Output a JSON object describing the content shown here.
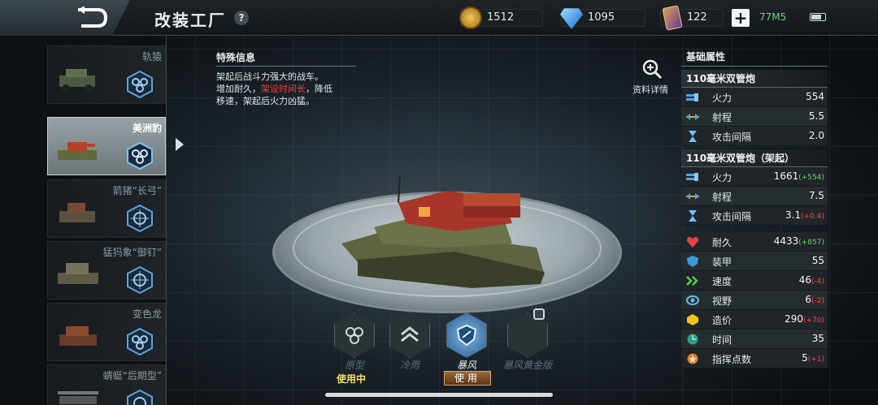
{
  "header": {
    "title": "改装工厂",
    "help_label": "?",
    "coins": "1512",
    "gems": "1095",
    "cards": "122",
    "plus_label": "+",
    "network": "77M5"
  },
  "vehicle_list": [
    {
      "name": "轨猿"
    },
    {
      "name": "美洲豹",
      "selected": true
    },
    {
      "name": "箭猪“长弓”"
    },
    {
      "name": "猛犸象“御钉”"
    },
    {
      "name": "变色龙"
    },
    {
      "name": "蜻蜓“后期型”"
    }
  ],
  "special_info": {
    "heading": "特殊信息",
    "line1": "架起后战斗力强大的战车。",
    "line2_prefix": "增加耐久，",
    "line2_red": "架设时间长",
    "line2_suffix": "，降低",
    "line3": "移速，架起后火力凶猛。"
  },
  "detail_label": "资料详情",
  "skins": [
    {
      "name": "原型",
      "status": "使用中"
    },
    {
      "name": "冷雨"
    },
    {
      "name": "暴风",
      "button": "使用"
    },
    {
      "name": "暴风黄金版",
      "locked": true
    }
  ],
  "stats": {
    "heading": "基础属性",
    "weapon1": {
      "name": "110毫米双管炮",
      "rows": [
        {
          "label": "火力",
          "value": "554"
        },
        {
          "label": "射程",
          "value": "5.5"
        },
        {
          "label": "攻击间隔",
          "value": "2.0"
        }
      ]
    },
    "weapon2": {
      "name": "110毫米双管炮（架起）",
      "rows": [
        {
          "label": "火力",
          "value": "1661",
          "delta": "(+554)",
          "delta_color": "green"
        },
        {
          "label": "射程",
          "value": "7.5"
        },
        {
          "label": "攻击间隔",
          "value": "3.1",
          "delta": "(+0.4)",
          "delta_color": "red"
        }
      ]
    },
    "body": [
      {
        "label": "耐久",
        "value": "4433",
        "delta": "(+857)",
        "delta_color": "green",
        "icon": "heart-icon"
      },
      {
        "label": "装甲",
        "value": "55",
        "icon": "armor-icon"
      },
      {
        "label": "速度",
        "value": "46",
        "delta": "(-4)",
        "delta_color": "red",
        "icon": "speed-icon"
      },
      {
        "label": "视野",
        "value": "6",
        "delta": "(-2)",
        "delta_color": "red",
        "icon": "eye-icon"
      },
      {
        "label": "造价",
        "value": "290",
        "delta": "(+70)",
        "delta_color": "red",
        "icon": "cost-icon"
      },
      {
        "label": "时间",
        "value": "35",
        "icon": "clock-icon"
      },
      {
        "label": "指挥点数",
        "value": "5",
        "delta": "(+1)",
        "delta_color": "red",
        "icon": "command-icon"
      }
    ]
  },
  "colors": {
    "accent_green": "#6fd56f",
    "accent_red": "#ff4a3d",
    "selected_bg": "#98a3a7"
  }
}
